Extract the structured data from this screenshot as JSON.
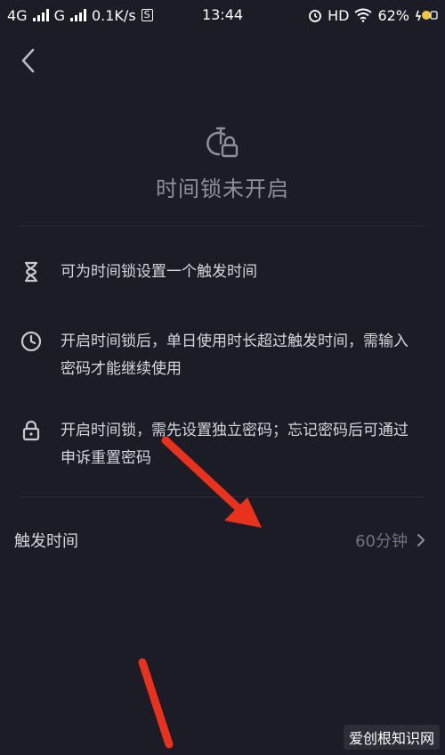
{
  "status_bar": {
    "network1": "4G",
    "network2": "G",
    "speed": "0.1K/s",
    "s_badge": "S",
    "time": "13:44",
    "hd": "HD",
    "battery": "62%"
  },
  "nav": {
    "back_icon": "chevron-left-icon"
  },
  "hero": {
    "icon": "timer-lock-icon",
    "title": "时间锁未开启"
  },
  "features": [
    {
      "icon": "hourglass-icon",
      "text": "可为时间锁设置一个触发时间"
    },
    {
      "icon": "clock-icon",
      "text": "开启时间锁后，单日使用时长超过触发时间，需输入密码才能继续使用"
    },
    {
      "icon": "lock-icon",
      "text": "开启时间锁，需先设置独立密码；忘记密码后可通过申诉重置密码"
    }
  ],
  "trigger_row": {
    "label": "触发时间",
    "value": "60分钟",
    "chevron": "chevron-right-icon"
  },
  "watermark": {
    "text": "爱创根知识网"
  },
  "colors": {
    "background": "#1b1c26",
    "annotation_arrow": "#e8321e"
  }
}
